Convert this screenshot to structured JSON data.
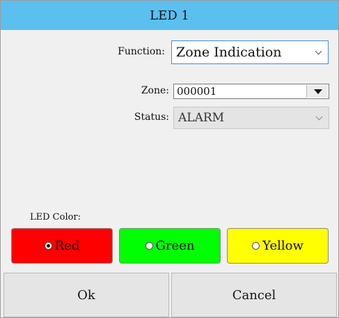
{
  "dialog": {
    "title": "LED 1"
  },
  "function_field": {
    "label": "Function:",
    "value": "Zone Indication"
  },
  "zone_field": {
    "label": "Zone:",
    "value": "000001"
  },
  "status_field": {
    "label": "Status:",
    "value": "ALARM"
  },
  "led_color": {
    "label": "LED Color:",
    "options": [
      {
        "label": "Red",
        "color": "#ff0000",
        "selected": true
      },
      {
        "label": "Green",
        "color": "#00ff00",
        "selected": false
      },
      {
        "label": "Yellow",
        "color": "#ffff00",
        "selected": false
      }
    ]
  },
  "footer": {
    "ok_label": "Ok",
    "cancel_label": "Cancel"
  },
  "colors": {
    "titlebar": "#5bc0f0",
    "focus_border": "#3d8fd6"
  }
}
